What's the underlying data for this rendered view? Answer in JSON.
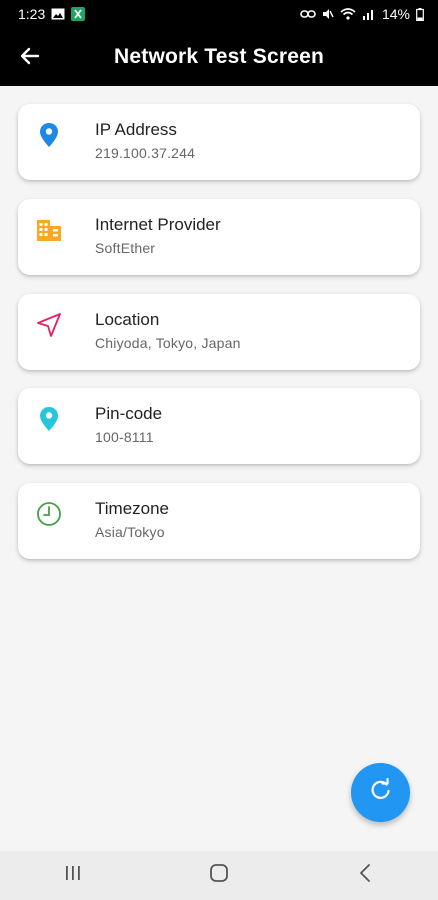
{
  "status_bar": {
    "time": "1:23",
    "battery": "14%"
  },
  "app_bar": {
    "title": "Network Test Screen",
    "back_icon": "arrow-left-icon"
  },
  "colors": {
    "app_bar_bg": "#000000",
    "fab_bg": "#2196f3",
    "ip_icon": "#1e88e5",
    "provider_icon": "#f9a825",
    "location_icon": "#e91e63",
    "pincode_icon": "#26c6da",
    "timezone_icon": "#43a047"
  },
  "cards": [
    {
      "title": "IP Address",
      "value": "219.100.37.244",
      "icon": "map-pin-icon"
    },
    {
      "title": "Internet Provider",
      "value": "SoftEther",
      "icon": "building-icon"
    },
    {
      "title": "Location",
      "value": "Chiyoda, Tokyo, Japan",
      "icon": "navigation-arrow-icon"
    },
    {
      "title": "Pin-code",
      "value": "100-8111",
      "icon": "map-pin-icon"
    },
    {
      "title": "Timezone",
      "value": "Asia/Tokyo",
      "icon": "clock-icon"
    }
  ],
  "fab": {
    "icon": "refresh-icon"
  },
  "nav": {
    "recents_icon": "recents-icon",
    "home_icon": "home-icon",
    "back_icon": "back-chevron-icon"
  }
}
